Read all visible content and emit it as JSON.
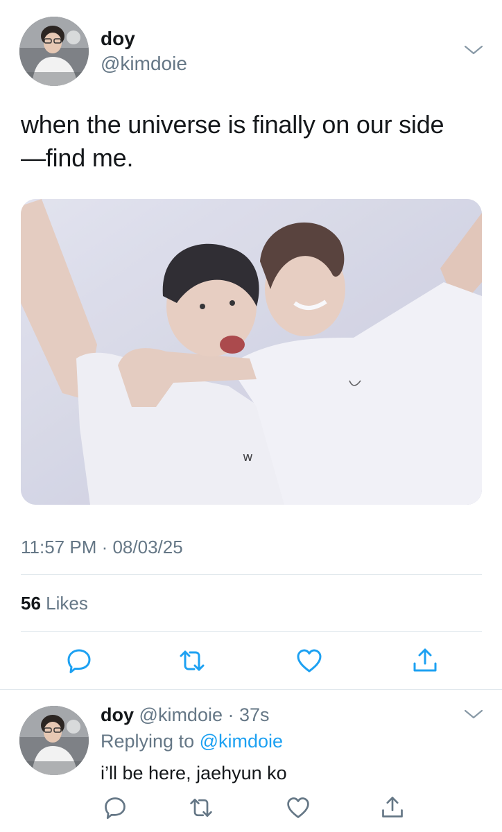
{
  "main_tweet": {
    "display_name": "doy",
    "handle": "@kimdoie",
    "text": "when the universe is finally on our side\n—find me.",
    "timestamp": "11:57 PM · 08/03/25",
    "likes_count": "56",
    "likes_label": "Likes",
    "actions": {
      "reply_icon": "reply-icon",
      "retweet_icon": "retweet-icon",
      "like_icon": "heart-icon",
      "share_icon": "share-icon"
    }
  },
  "reply_tweet": {
    "display_name": "doy",
    "handle_time": "@kimdoie · 37s",
    "replying_prefix": "Replying to",
    "replying_to": "@kimdoie",
    "text": "i’ll be here, jaehyun ko"
  },
  "colors": {
    "text_primary": "#14171a",
    "text_secondary": "#657786",
    "link": "#1da1f2",
    "divider": "#e1e8ed"
  }
}
